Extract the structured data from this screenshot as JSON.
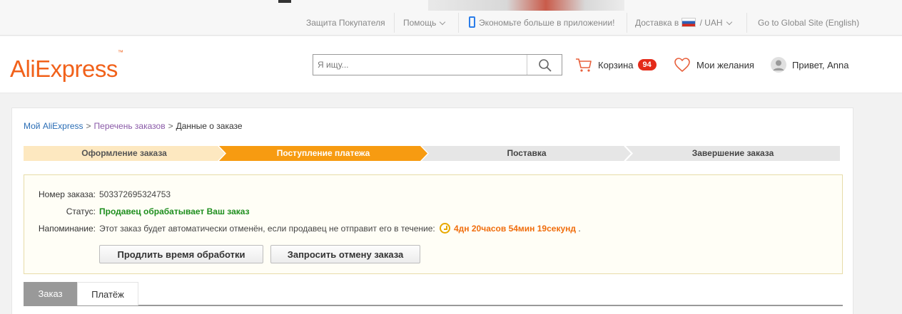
{
  "topbar": {
    "buyer_protection": "Защита Покупателя",
    "help": "Помощь",
    "app_promo": "Экономьте больше в приложении!",
    "shipping_label": "Доставка в",
    "currency": "/ UAH",
    "global_site": "Go to Global Site (English)"
  },
  "header": {
    "logo": "AliExpress",
    "search_placeholder": "Я ищу...",
    "cart_label": "Корзина",
    "cart_count": "94",
    "wishlist_label": "Мои желания",
    "greeting": "Привет, Anna"
  },
  "breadcrumb": {
    "items": [
      "Мой AliExpress",
      "Перечень заказов"
    ],
    "separator": ">",
    "current": "Данные о заказе"
  },
  "steps": [
    {
      "label": "Оформление заказа",
      "state": "done"
    },
    {
      "label": "Поступление платежа",
      "state": "current"
    },
    {
      "label": "Поставка",
      "state": "pending"
    },
    {
      "label": "Завершение заказа",
      "state": "pending"
    }
  ],
  "order": {
    "number_label": "Номер заказа:",
    "number": "503372695324753",
    "status_label": "Статус:",
    "status": "Продавец обрабатывает Ваш заказ",
    "reminder_label": "Напоминание:",
    "reminder_text": "Этот заказ будет автоматически отменён, если продавец не отправит его в течение:",
    "countdown": "4дн 20часов 54мин 19секунд",
    "countdown_suffix": ".",
    "extend_button": "Продлить время обработки",
    "cancel_button": "Запросить отмену заказа"
  },
  "tabs": [
    "Заказ",
    "Платёж"
  ],
  "colors": {
    "brand": "#f1611a",
    "step_done": "#fde8c0",
    "step_current": "#f79b11",
    "step_pending": "#e6e6e6",
    "status_green": "#1e8e1e",
    "countdown_orange": "#f06d0c",
    "badge_red": "#e42a19"
  }
}
